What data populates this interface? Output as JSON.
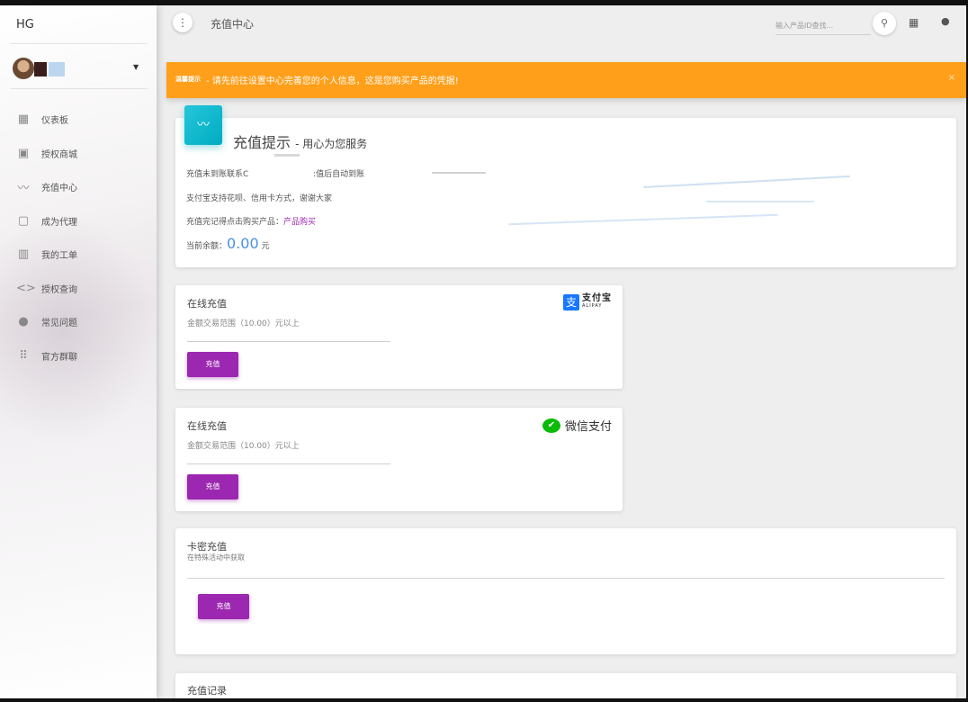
{
  "sidebar": {
    "brand": "HG",
    "items": [
      {
        "label": "仪表板",
        "icon": "dashboard-icon",
        "glyph": "▦"
      },
      {
        "label": "授权商城",
        "icon": "store-icon",
        "glyph": "▣"
      },
      {
        "label": "充值中心",
        "icon": "trend-icon",
        "glyph": "〰"
      },
      {
        "label": "成为代理",
        "icon": "clipboard-icon",
        "glyph": "▢"
      },
      {
        "label": "我的工单",
        "icon": "building-icon",
        "glyph": "▥"
      },
      {
        "label": "授权查询",
        "icon": "code-icon",
        "glyph": "<>"
      },
      {
        "label": "常见问题",
        "icon": "location-pin-icon",
        "glyph": "●"
      },
      {
        "label": "官方群聊",
        "icon": "apps-grid-icon",
        "glyph": "⠿"
      }
    ]
  },
  "header": {
    "title": "充值中心",
    "search_placeholder": "输入产品ID查找..."
  },
  "alert": {
    "title": "温馨提示",
    "text": "- 请先前往设置中心完善您的个人信息，这是您购买产品的凭据!",
    "close": "×"
  },
  "notice": {
    "title": "充值提示",
    "subtitle": "- 用心为您服务",
    "line1_a": "充值未到账联系C",
    "line1_b": ":值后自动到账",
    "line2": "支付宝支持花呗、信用卡方式，谢谢大家",
    "line3_prefix": "充值完记得点击购买产品：",
    "line3_link": "产品购买",
    "balance_label": "当前余额：",
    "balance_value": "0.00",
    "balance_unit": "元"
  },
  "alipay": {
    "title": "在线充值",
    "range": "金额交易范围（10.00）元以上",
    "button": "充值",
    "logo_cn": "支付宝",
    "logo_en": "ALIPAY",
    "logo_mark": "支",
    "brand_color": "#1677ff"
  },
  "wechat": {
    "title": "在线充值",
    "range": "金额交易范围（10.00）元以上",
    "button": "充值",
    "logo_text": "微信支付",
    "brand_color": "#09bb07"
  },
  "card_key": {
    "title": "卡密充值",
    "subtitle": "在特殊活动中获取",
    "button": "充值"
  },
  "records": {
    "title": "充值记录"
  },
  "colors": {
    "accent": "#9c27b0",
    "alert": "#ff9f1a",
    "badge": "#00acc1",
    "balance": "#4a90e2"
  }
}
